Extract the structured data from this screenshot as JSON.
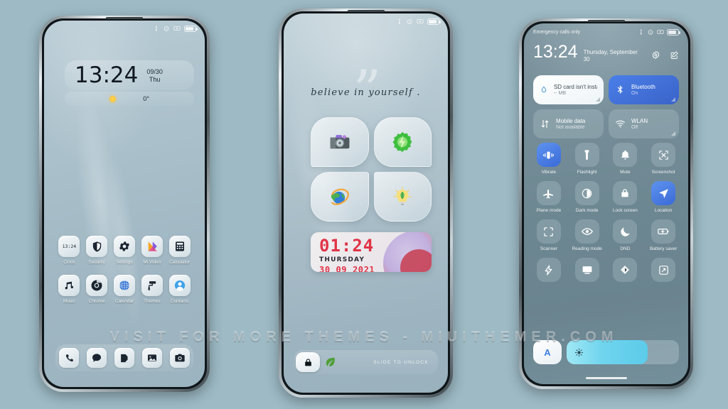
{
  "background_color": "#9dbac5",
  "watermark": "VISIT FOR MORE THEMES - MIUITHEMER.COM",
  "phone1": {
    "name": "lock-home-screen",
    "status_bar": {
      "icons": [
        "bluetooth-icon",
        "alarm-icon",
        "screen-record-icon",
        "battery-icon"
      ]
    },
    "clock_widget": {
      "time": "13:24",
      "date": "09/30",
      "weekday": "Thu"
    },
    "weather_widget": {
      "icon": "sun-icon",
      "temperature": "0°"
    },
    "apps": [
      {
        "label": "Clock",
        "icon": "clock-icon",
        "badge": "13:24"
      },
      {
        "label": "Security",
        "icon": "shield-icon"
      },
      {
        "label": "Settings",
        "icon": "gear-icon"
      },
      {
        "label": "Mi Video",
        "icon": "play-icon"
      },
      {
        "label": "Calculator",
        "icon": "calculator-icon"
      },
      {
        "label": "Music",
        "icon": "music-note-icon"
      },
      {
        "label": "Chrome",
        "icon": "chrome-icon"
      },
      {
        "label": "Calendar",
        "icon": "calendar-globe-icon"
      },
      {
        "label": "Themes",
        "icon": "paint-roller-icon"
      },
      {
        "label": "Contacts",
        "icon": "contact-avatar-icon"
      }
    ],
    "dock": [
      {
        "label": "Phone",
        "icon": "phone-icon"
      },
      {
        "label": "Messages",
        "icon": "message-bubble-icon"
      },
      {
        "label": "Notes",
        "icon": "notes-icon"
      },
      {
        "label": "Gallery",
        "icon": "gallery-icon"
      },
      {
        "label": "Camera",
        "icon": "camera-icon"
      }
    ]
  },
  "phone2": {
    "name": "lock-screen",
    "quote": "believe in yourself .",
    "quote_marks": "”",
    "icons": [
      {
        "label": "Camera",
        "icon": "camera-color-icon"
      },
      {
        "label": "Optimizer",
        "icon": "gear-lightning-icon"
      },
      {
        "label": "Browser",
        "icon": "globe-orbit-icon"
      },
      {
        "label": "Ideas",
        "icon": "lightbulb-leaf-icon"
      }
    ],
    "digital_clock": {
      "time": "01:24",
      "weekday": "THURSDAY",
      "date": "30 09 2021"
    },
    "unlock": {
      "icon": "lock-icon",
      "decor": "leaf-icon",
      "hint": "SLIDE TO UNLOCK"
    }
  },
  "phone3": {
    "name": "control-center",
    "carrier": "Emergency calls only",
    "status_icons": [
      "bluetooth-icon",
      "alarm-icon",
      "screen-record-icon",
      "battery-icon"
    ],
    "time": "13:24",
    "date": "Thursday, September 30",
    "header_icons": [
      "settings-gear-icon",
      "edit-icon"
    ],
    "big_tiles": [
      {
        "title": "SD card isn't installed",
        "sub": "-- MB",
        "icon": "water-drop-icon",
        "state": "white"
      },
      {
        "title": "Bluetooth",
        "sub": "On",
        "icon": "bluetooth-icon",
        "state": "blue"
      },
      {
        "title": "Mobile data",
        "sub": "Not available",
        "icon": "data-arrows-icon",
        "state": "off"
      },
      {
        "title": "WLAN",
        "sub": "Off",
        "icon": "wifi-icon",
        "state": "off"
      }
    ],
    "toggles": [
      {
        "label": "Vibrate",
        "icon": "vibrate-icon",
        "on": true
      },
      {
        "label": "Flashlight",
        "icon": "flashlight-icon",
        "on": false
      },
      {
        "label": "Mute",
        "icon": "bell-icon",
        "on": false
      },
      {
        "label": "Screenshot",
        "icon": "screenshot-icon",
        "on": false
      },
      {
        "label": "Plane mode",
        "icon": "airplane-icon",
        "on": false
      },
      {
        "label": "Dark mode",
        "icon": "contrast-icon",
        "on": false
      },
      {
        "label": "Lock screen",
        "icon": "padlock-icon",
        "on": false
      },
      {
        "label": "Location",
        "icon": "location-arrow-icon",
        "on": true
      },
      {
        "label": "Scanner",
        "icon": "scan-frame-icon",
        "on": false
      },
      {
        "label": "Reading mode",
        "icon": "eye-icon",
        "on": false
      },
      {
        "label": "DND",
        "icon": "moon-icon",
        "on": false
      },
      {
        "label": "Battery saver",
        "icon": "battery-plus-icon",
        "on": false
      },
      {
        "label": "",
        "icon": "lightning-icon",
        "on": false
      },
      {
        "label": "",
        "icon": "cast-icon",
        "on": false
      },
      {
        "label": "",
        "icon": "nfc-icon",
        "on": false
      },
      {
        "label": "",
        "icon": "rotate-icon",
        "on": false
      }
    ],
    "brightness": {
      "auto_label": "A",
      "icon": "brightness-sun-icon",
      "value": 72
    }
  }
}
